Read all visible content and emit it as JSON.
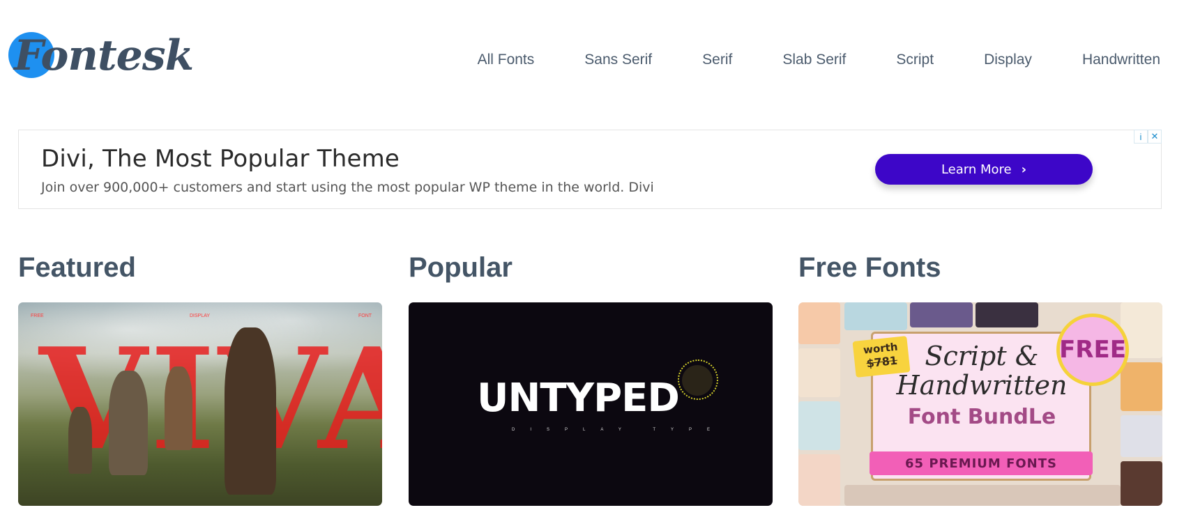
{
  "header": {
    "logo_text": "Fontesk",
    "nav": [
      "All Fonts",
      "Sans Serif",
      "Serif",
      "Slab Serif",
      "Script",
      "Display",
      "Handwritten"
    ]
  },
  "ad": {
    "title": "Divi, The Most Popular Theme",
    "description": "Join over 900,000+ customers and start using the most popular WP theme in the world. Divi",
    "button_label": "Learn More",
    "info_icon": "i",
    "close_icon": "✕"
  },
  "sections": {
    "featured": {
      "title": "Featured",
      "art_letters": "VIVA",
      "tags": [
        "FREE",
        "DISPLAY",
        "FONT"
      ]
    },
    "popular": {
      "title": "Popular",
      "art_word": "UNTYPED",
      "art_sub": "DISPLAY TYPE"
    },
    "free": {
      "title": "Free Fonts",
      "worth_label": "worth",
      "worth_price": "$781",
      "badge": "FREE",
      "script_line": "Script & Handwritten",
      "bundle_line": "Font BundLe",
      "bar_text": "65 PREMIUM FONTS"
    }
  },
  "colors": {
    "accent": "#3d06c8",
    "logo_blue": "#1e90f0",
    "heading": "#445566"
  }
}
